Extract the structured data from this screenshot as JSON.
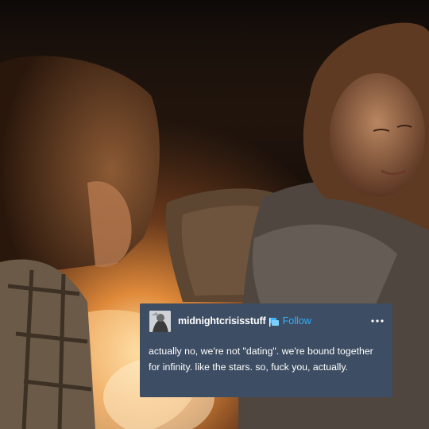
{
  "post": {
    "username": "midnightcrisisstuff",
    "follow_label": "Follow",
    "body_text": "actually no, we're not \"dating\". we're bound together for infinity. like the stars. so, fuck you, actually.",
    "avatar_icon": "profile-photo-avatar",
    "badge_icon": "blue-flag-badge-icon",
    "more_icon": "more-options-icon"
  },
  "colors": {
    "card_background": "#3d4d64",
    "follow_link": "#2fb1ff",
    "text": "#ffffff"
  }
}
